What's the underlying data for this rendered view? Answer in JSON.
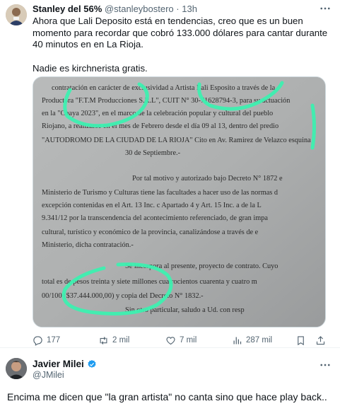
{
  "tweet1": {
    "author_name": "Stanley del 56%",
    "handle": "@stanleybostero",
    "separator": "·",
    "time": "13h",
    "text_p1": "Ahora que Lali Deposito está en tendencias, creo que es un buen momento para recordar que cobró 133.000 dólares para cantar durante 40 minutos en en La Rioja.",
    "text_p2": "Nadie es kirchnerista gratis.",
    "image": {
      "lines": [
        "contratación en carácter de exclusividad a Artista Lali Esposito a través de la",
        "Productora \"F.T.M Producciones S.R.L\", CUIT N° 30-71628794-3, para su actuación",
        "en la \"Chaya 2023\", en el marco de la celebración popular y cultural del pueblo",
        "Riojano, a realizarse en el mes de Febrero desde el día 09 al 13, dentro del predio",
        "\"AUTODROMO DE LA CIUDAD DE LA RIOJA\" Cito en Av. Ramirez de Velazco esquina",
        "30 de Septiembre.-",
        "Por tal motivo y autorizado bajo Decreto N° 1872 e",
        "Ministerio de Turismo y Culturas tiene las facultades a hacer uso de las normas d",
        "excepción contenidas en el Art. 13 Inc. c Apartado 4 y Art. 15 Inc. a de la L",
        "9.341/12 por la transcendencia del acontecimiento referenciado, de gran impa",
        "cultural, turístico y económico de la provincia, canalizándose a través de e",
        "Ministerio, dicha contratación.-",
        "Se incorpora al presente, proyecto de contrato. Cuyo",
        "total es de pesos treinta y siete millones cuatrocientos cuarenta y cuatro m",
        "00/100 ($37.444.000,00) y copia del Decreto N° 1832.-",
        "Sin otro particular, saludo a Ud. con resp"
      ]
    },
    "actions": {
      "replies": "177",
      "retweets": "2 mil",
      "likes": "7 mil",
      "views": "287 mil"
    }
  },
  "tweet2": {
    "author_name": "Javier Milei",
    "handle": "@JMilei",
    "text": "Encima me dicen que \"la gran artista\" no canta sino que hace play back.."
  },
  "colors": {
    "text": "#0f1419",
    "secondary": "#536471",
    "verified": "#1d9bf0",
    "highlight_marker": "#3df0b0",
    "divider": "#eff3f4"
  }
}
